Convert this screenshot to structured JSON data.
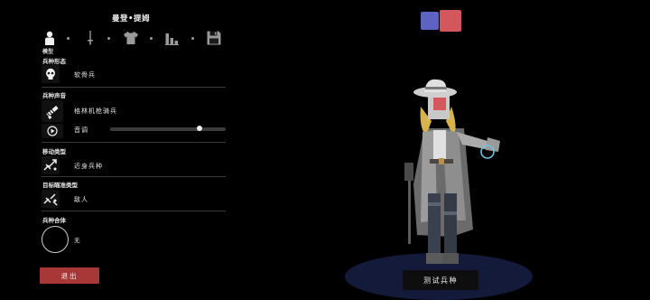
{
  "header": {
    "title": "曼登•提姆"
  },
  "tabs": {
    "items": [
      {
        "icon": "person-icon"
      },
      {
        "icon": "sword-icon"
      },
      {
        "icon": "shirt-icon"
      },
      {
        "icon": "stats-icon"
      },
      {
        "icon": "save-icon"
      }
    ],
    "active_label": "模型"
  },
  "sections": {
    "form": {
      "label": "兵种形态",
      "value": "软骨兵",
      "icon": "skull-icon"
    },
    "voice": {
      "label": "兵种声音",
      "value": "格林机枪骑兵",
      "icon": "gun-icon",
      "pitch_label": "音调",
      "pitch_value": 0.77,
      "play_icon": "play-icon"
    },
    "move": {
      "label": "移动类型",
      "value": "近身兵种",
      "icon": "melee-icon"
    },
    "target": {
      "label": "目标瞄准类型",
      "value": "敌人",
      "icon": "target-icon"
    },
    "mount": {
      "label": "兵种合体",
      "value": "无"
    }
  },
  "buttons": {
    "exit": "退出",
    "test": "测试兵种"
  },
  "colors": {
    "primary": "#5c63c0",
    "secondary": "#d4575e",
    "exit_button": "#a83737"
  }
}
